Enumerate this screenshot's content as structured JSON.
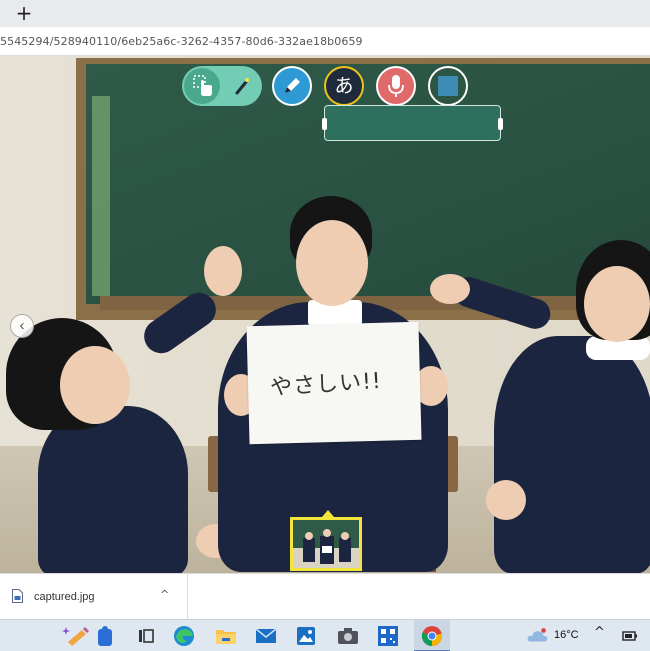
{
  "browser": {
    "newtab_label": "+",
    "url": "5545294/528940110/6eb25a6c-3262-4357-80d6-332ae18b0659"
  },
  "toolbar": {
    "textbox_value": "",
    "ja_glyph": "あ",
    "colors": {
      "select_toggle": "#72cdb4",
      "pen": "#2d9ad6",
      "text": "#f0c21c",
      "mic": "#e06a6a",
      "square": "#3d8bb7"
    }
  },
  "scene": {
    "paper_text": "やさしい!!",
    "prev_arrow": "‹"
  },
  "downloads": {
    "file_name": "captured.jpg",
    "chevron": "^"
  },
  "taskbar": {
    "temperature": "16°C",
    "tray_chevron": "^"
  }
}
